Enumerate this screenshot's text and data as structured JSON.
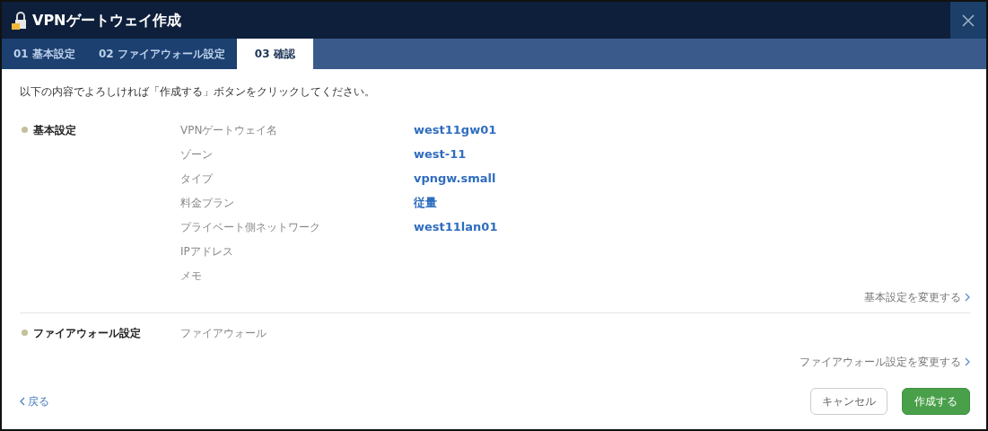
{
  "window": {
    "title": "VPNゲートウェイ作成"
  },
  "tabs": [
    {
      "label": "01 基本設定",
      "selected": false
    },
    {
      "label": "02 ファイアウォール設定",
      "selected": false
    },
    {
      "label": "03 確認",
      "selected": true
    }
  ],
  "instruction": "以下の内容でよろしければ「作成する」ボタンをクリックしてください。",
  "sections": [
    {
      "title": "基本設定",
      "fields": [
        {
          "label": "VPNゲートウェイ名",
          "value": "west11gw01"
        },
        {
          "label": "ゾーン",
          "value": "west-11"
        },
        {
          "label": "タイプ",
          "value": "vpngw.small"
        },
        {
          "label": "料金プラン",
          "value": "従量"
        },
        {
          "label": "プライベート側ネットワーク",
          "value": "west11lan01"
        },
        {
          "label": "IPアドレス"
        },
        {
          "label": "メモ"
        }
      ],
      "change_link": "基本設定を変更する"
    },
    {
      "title": "ファイアウォール設定",
      "fields": [
        {
          "label": "ファイアウォール"
        }
      ],
      "change_link": "ファイアウォール設定を変更する"
    }
  ],
  "back_link": "戻る",
  "buttons": [
    {
      "label": "キャンセル",
      "kind": "secondary"
    },
    {
      "label": "作成する",
      "kind": "primary"
    }
  ]
}
